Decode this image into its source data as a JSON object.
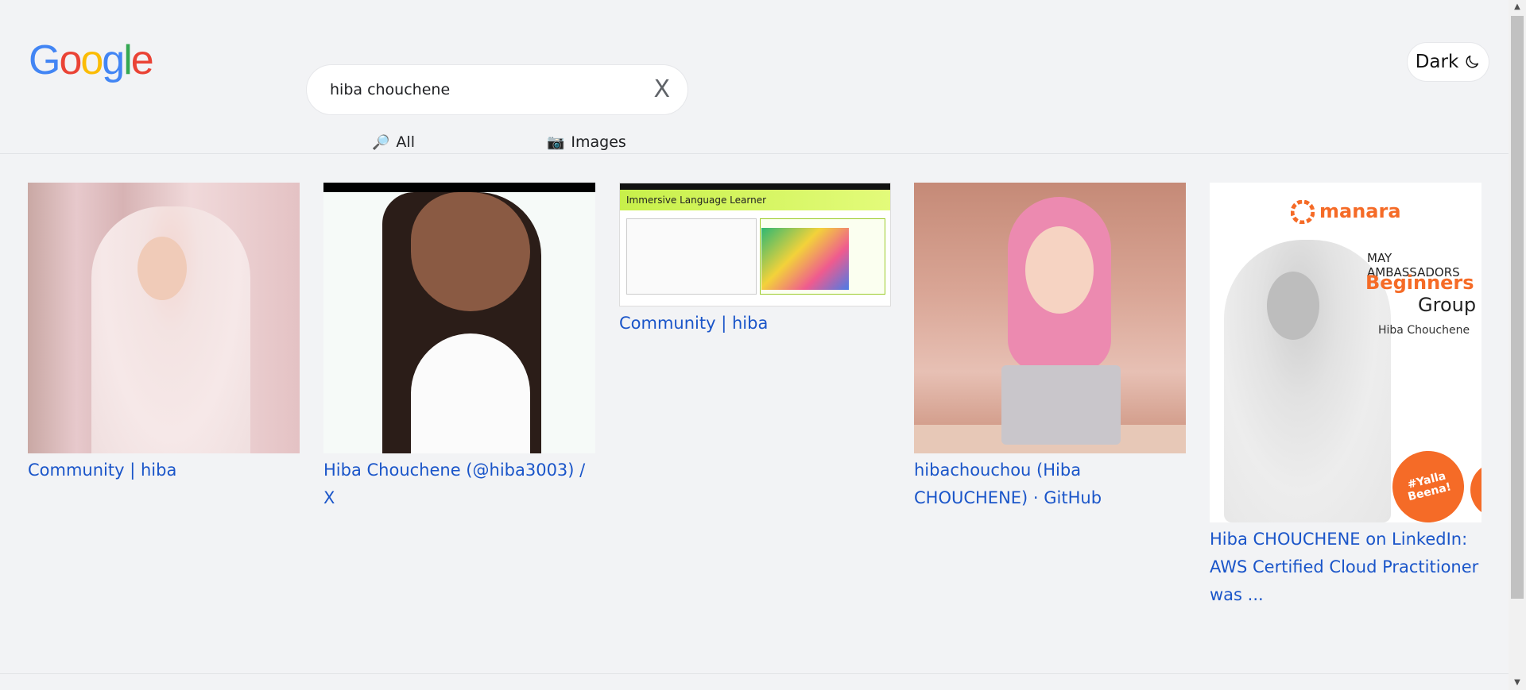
{
  "logo": {
    "letters": [
      "G",
      "o",
      "o",
      "g",
      "l",
      "e"
    ],
    "colors": [
      "#4285F4",
      "#EA4335",
      "#FBBC05",
      "#4285F4",
      "#34A853",
      "#EA4335"
    ]
  },
  "search": {
    "value": "hiba chouchene",
    "clear_label": "X"
  },
  "tabs": [
    {
      "icon": "🔎",
      "label": "All"
    },
    {
      "icon": "📷",
      "label": "Images"
    }
  ],
  "theme_toggle": {
    "label": "Dark",
    "icon": "moon-icon"
  },
  "results": [
    {
      "title": "Community | hiba"
    },
    {
      "title": "Hiba Chouchene (@hiba3003) / X"
    },
    {
      "title": "Community | hiba",
      "image_header": "Immersive Language Learner"
    },
    {
      "title": "hibachouchou (Hiba CHOUCHENE) · GitHub"
    },
    {
      "title": "Hiba CHOUCHENE on LinkedIn: AWS Certified Cloud Practitioner was ...",
      "image_text": {
        "brand": "manara",
        "line1": "MAY AMBASSADORS",
        "line2": "Beginners",
        "line3": "Group",
        "line4": "Hiba Chouchene",
        "badge": "#Yalla Beena!"
      }
    }
  ],
  "colors": {
    "link": "#1a55c9",
    "background": "#f2f3f5",
    "accent_orange": "#f56b27"
  }
}
